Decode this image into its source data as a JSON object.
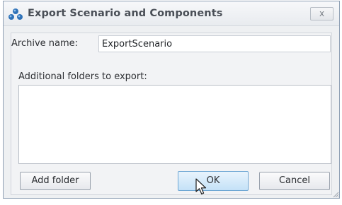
{
  "window": {
    "title": "Export Scenario and Components",
    "close_label": "x"
  },
  "form": {
    "archive_label": "Archive name:",
    "archive_value": "ExportScenario",
    "folders_label": "Additional folders to export:",
    "folders": []
  },
  "buttons": {
    "add_folder": "Add folder",
    "ok": "OK",
    "cancel": "Cancel"
  },
  "colors": {
    "icon_blue": "#2f72b8",
    "ok_highlight": "#c4e1f7"
  }
}
